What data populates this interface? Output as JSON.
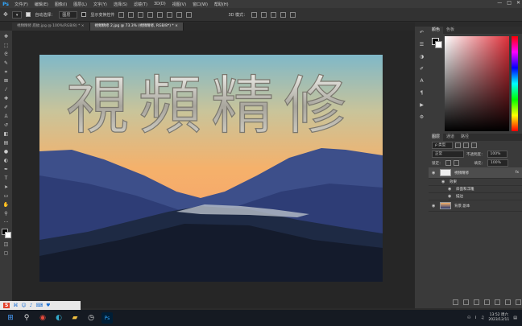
{
  "menubar": {
    "logo": "Ps",
    "items": [
      "文件(F)",
      "编辑(E)",
      "图像(I)",
      "图层(L)",
      "文字(Y)",
      "选择(S)",
      "滤镜(T)",
      "3D(D)",
      "视图(V)",
      "窗口(W)",
      "帮助(H)"
    ],
    "window_controls": [
      "—",
      "□",
      "✕"
    ]
  },
  "options": {
    "auto_select_label": "自动选择：",
    "auto_select_value": "图层",
    "show_transform_label": "显示变换控件",
    "mode_3d_label": "3D 模式："
  },
  "tabs": [
    {
      "label": "視頻精修 底紋.jpg @ 100%(RGB/8) *  ×",
      "active": false
    },
    {
      "label": "視頻精修 2.jpg @ 73.3% (視頻精修, RGB/8*) *  ×",
      "active": true
    }
  ],
  "canvas": {
    "title_text": "視頻精修"
  },
  "color_panel": {
    "tabs": [
      "颜色",
      "色板"
    ]
  },
  "layers_panel": {
    "tabs": [
      "图层",
      "通道",
      "路径"
    ],
    "filter_label": "ρ 类型",
    "blend_mode": "正常",
    "opacity_label": "不透明度：",
    "opacity_value": "100%",
    "lock_label": "锁定：",
    "fill_label": "填充：",
    "fill_value": "100%",
    "layers": [
      {
        "name": "視頻精修",
        "badge": "fx"
      },
      {
        "name": "效果"
      },
      {
        "name": "斜面和浮雕"
      },
      {
        "name": "描边"
      },
      {
        "name": "背景 副本"
      }
    ]
  },
  "taskbar": {
    "time": "13:52 周六",
    "date": "2023/12/11",
    "ime_label": "S"
  }
}
